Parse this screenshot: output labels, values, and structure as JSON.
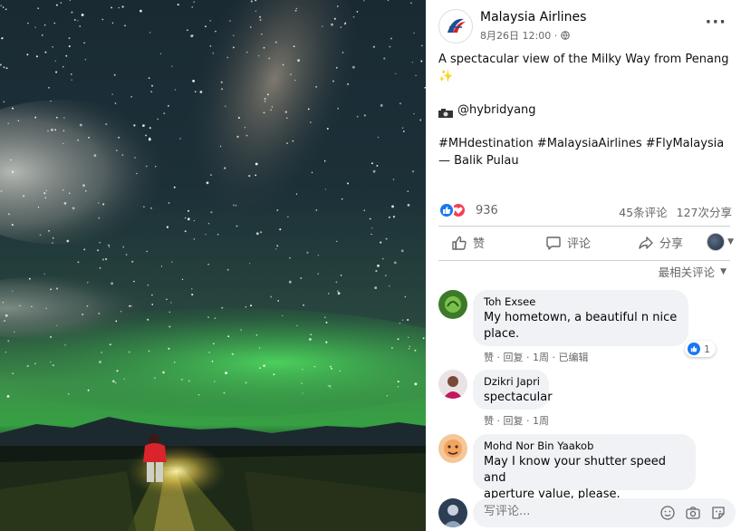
{
  "post": {
    "page_name": "Malaysia Airlines",
    "timestamp": "8月26日 12:00 ·",
    "text_line1": "A spectacular view of the Milky Way from Penang",
    "sparkle": "✨",
    "credit": "@hybridyang",
    "hashtags": "#MHdestination #MalaysiaAirlines #FlyMalaysia",
    "location": "— Balik Pulau"
  },
  "stats": {
    "reactions_count": "936",
    "comments": "45条评论",
    "shares": "127次分享"
  },
  "actions": {
    "like": "赞",
    "comment": "评论",
    "share": "分享"
  },
  "sort_label": "最相关评论",
  "comments": [
    {
      "name": "Toh Exsee",
      "text_line1": "My hometown, a beautiful n nice",
      "text_line2": "place.",
      "meta": "赞 · 回复 · 1周 · 已编辑",
      "likes": "1"
    },
    {
      "name": "Dzikri Japri",
      "text_line1": "spectacular",
      "meta": "赞 · 回复 · 1周"
    },
    {
      "name": "Mohd Nor Bin Yaakob",
      "text_line1": "May I know your shutter speed and",
      "text_line2": "aperture value, please."
    }
  ],
  "composer": {
    "placeholder": "写评论..."
  },
  "icons": {
    "page_logo": "malaysia-airlines-logo",
    "globe": "globe-icon",
    "more": "more-icon",
    "like": "thumbs-up-icon",
    "love": "heart-icon",
    "comment": "speech-bubble-icon",
    "share": "share-arrow-icon",
    "emoji": "smiley-icon",
    "camera": "camera-icon",
    "gif": "gif-icon",
    "sticker": "sticker-icon"
  },
  "colors": {
    "facebook_blue": "#1877f2",
    "love_red": "#f33e58",
    "bubble_bg": "#f0f2f5",
    "meta_gray": "#65676b",
    "aurora_green": "#2fbf4a"
  }
}
